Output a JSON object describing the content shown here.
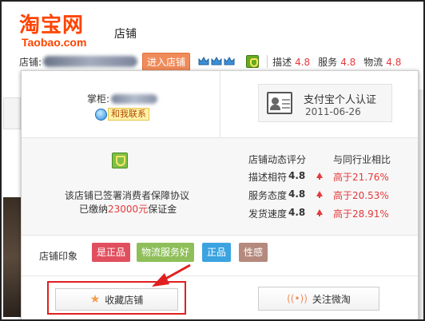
{
  "header": {
    "logo_cn": "淘宝网",
    "logo_en": "Taobao.com",
    "title": "店铺"
  },
  "topbar": {
    "shop_label": "店铺:",
    "enter_label": "进入店铺",
    "ratings": [
      {
        "label": "描述",
        "value": "4.8"
      },
      {
        "label": "服务",
        "value": "4.8"
      },
      {
        "label": "物流",
        "value": "4.8"
      }
    ]
  },
  "seller": {
    "keeper_label": "掌柜:",
    "contact_label": "和我联系"
  },
  "alipay": {
    "title": "支付宝个人认证",
    "date": "2011-06-26"
  },
  "assurance": {
    "line1": "该店铺已签署消费者保障协议",
    "line2_prefix": "已缴纳",
    "amount": "23000元",
    "line2_suffix": "保证金"
  },
  "scores": {
    "header_left": "店铺动态评分",
    "header_right": "与同行业相比",
    "rows": [
      {
        "label": "描述相符",
        "value": "4.8",
        "compare": "高于21.76%"
      },
      {
        "label": "服务态度",
        "value": "4.8",
        "compare": "高于20.53%"
      },
      {
        "label": "发货速度",
        "value": "4.8",
        "compare": "高于28.91%"
      }
    ]
  },
  "impressions": {
    "label": "店铺印象",
    "tags": [
      {
        "text": "是正品",
        "color": "#e14f5f"
      },
      {
        "text": "物流服务好",
        "color": "#8fbf5a"
      },
      {
        "text": "正品",
        "color": "#3ba3e0"
      },
      {
        "text": "性感",
        "color": "#b58a7e"
      }
    ]
  },
  "actions": {
    "favorite": "收藏店铺",
    "follow": "关注微淘"
  },
  "colors": {
    "brand": "#ff4400",
    "highlight": "#e02020",
    "up": "#e4393c"
  }
}
